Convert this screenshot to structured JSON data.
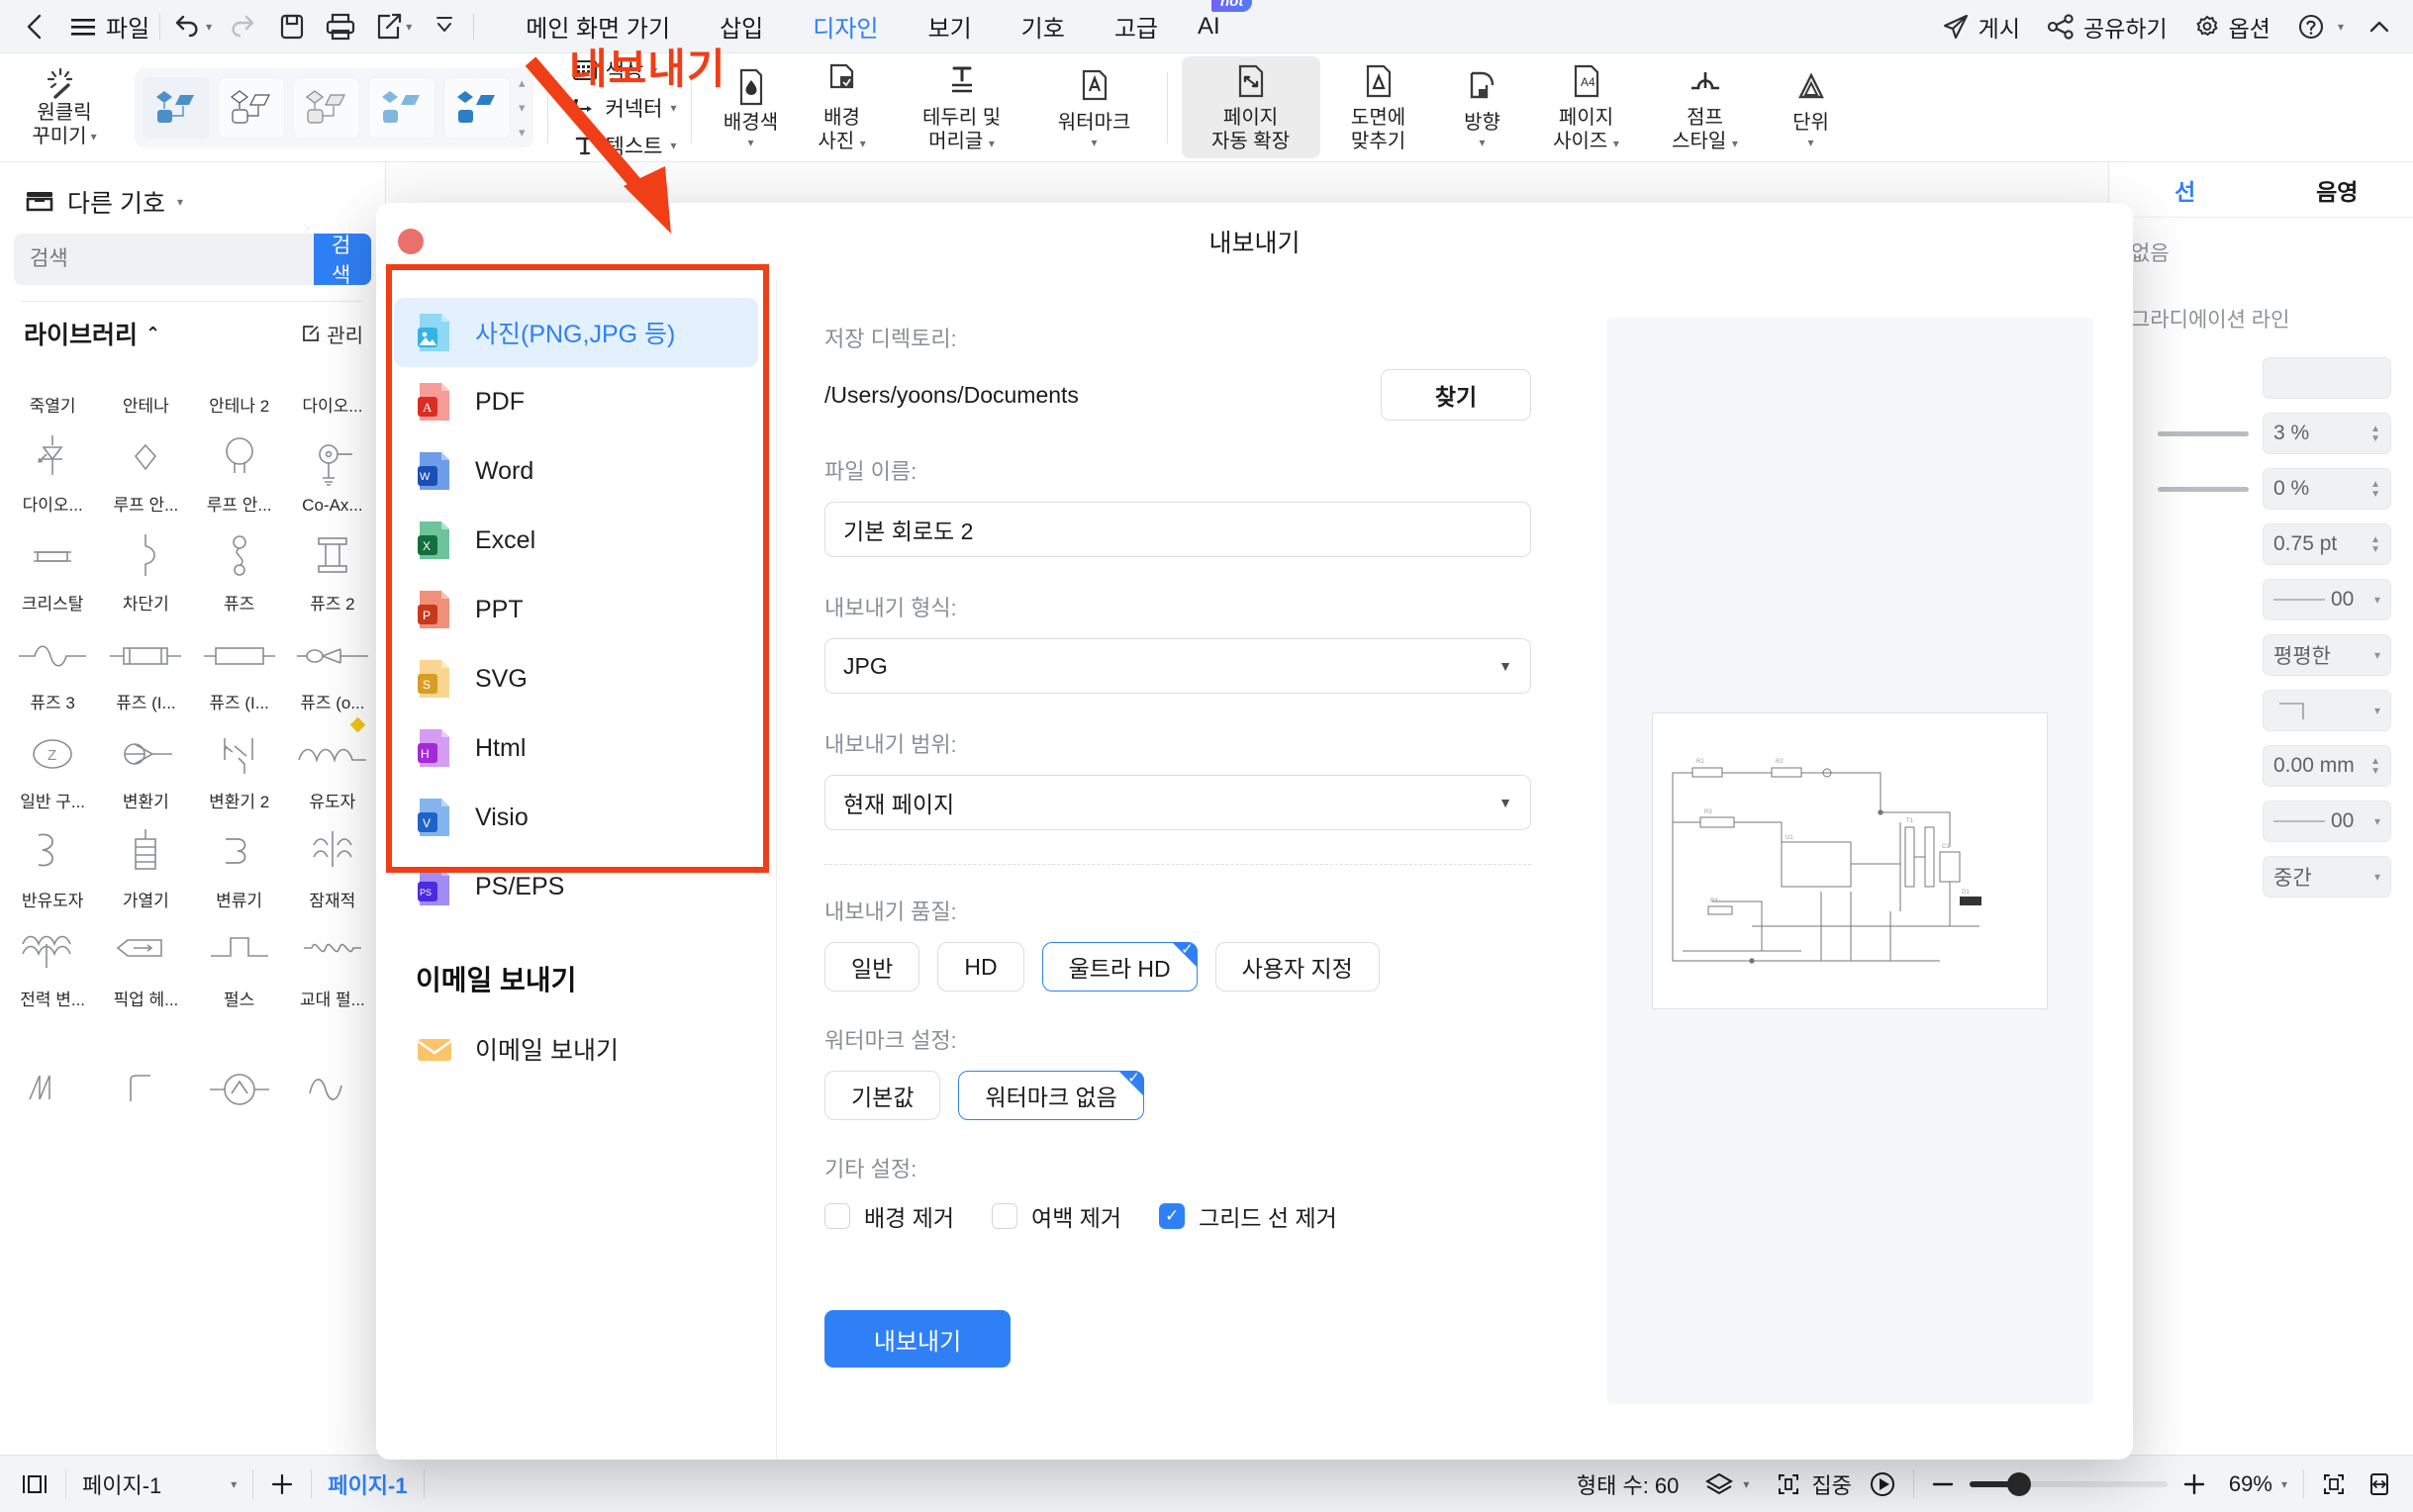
{
  "menubar": {
    "back_icon": "chevron-left-icon",
    "file_label": "파일",
    "undo_icon": "undo-icon",
    "redo_icon": "redo-icon",
    "save_icon": "save-icon",
    "print_icon": "print-icon",
    "export_share_icon": "share-export-icon",
    "more_icon": "chevron-down-icon",
    "tabs": [
      {
        "label": "메인 화면 가기",
        "active": false
      },
      {
        "label": "삽입",
        "active": false
      },
      {
        "label": "디자인",
        "active": true
      },
      {
        "label": "보기",
        "active": false
      },
      {
        "label": "기호",
        "active": false
      },
      {
        "label": "고급",
        "active": false
      }
    ],
    "ai_label": "AI",
    "ai_badge": "hot",
    "right_items": [
      {
        "label": "게시",
        "icon": "send-icon"
      },
      {
        "label": "공유하기",
        "icon": "share-nodes-icon"
      },
      {
        "label": "옵션",
        "icon": "gear-icon"
      },
      {
        "label": "",
        "icon": "help-circle-icon"
      },
      {
        "label": "",
        "icon": "chevron-up-icon"
      }
    ]
  },
  "ribbon": {
    "oneclick_line1": "원클릭",
    "oneclick_line2": "꾸미기",
    "theme_count": 5,
    "selected_theme_index": 0,
    "text_group": [
      {
        "label": "색상",
        "icon": "color-grid-icon"
      },
      {
        "label": "커넥터",
        "icon": "connector-icon"
      },
      {
        "label": "텍스트",
        "icon": "text-t-icon"
      }
    ],
    "buttons": [
      {
        "label_line1": "배경색",
        "label_line2": "",
        "icon": "bg-color-icon",
        "caret": true,
        "active": false
      },
      {
        "label_line1": "배경",
        "label_line2": "사진",
        "icon": "bg-photo-icon",
        "caret": true,
        "active": false
      },
      {
        "label_line1": "테두리 및",
        "label_line2": "머리글",
        "icon": "border-header-icon",
        "caret": true,
        "active": false
      },
      {
        "label_line1": "워터마크",
        "label_line2": "",
        "icon": "watermark-icon",
        "caret": true,
        "active": false
      },
      {
        "label_line1": "페이지",
        "label_line2": "자동 확장",
        "icon": "page-autoexpand-icon",
        "caret": false,
        "active": true
      },
      {
        "label_line1": "도면에",
        "label_line2": "맞추기",
        "icon": "fit-drawing-icon",
        "caret": false,
        "active": false
      },
      {
        "label_line1": "방향",
        "label_line2": "",
        "icon": "orientation-icon",
        "caret": true,
        "active": false
      },
      {
        "label_line1": "페이지",
        "label_line2": "사이즈",
        "icon": "page-size-icon",
        "caret": true,
        "active": false
      },
      {
        "label_line1": "점프",
        "label_line2": "스타일",
        "icon": "jump-style-icon",
        "caret": true,
        "active": false
      },
      {
        "label_line1": "단위",
        "label_line2": "",
        "icon": "unit-icon",
        "caret": true,
        "active": false
      }
    ]
  },
  "left_panel": {
    "header_label": "다른 기호",
    "header_icon": "library-box-icon",
    "search_placeholder": "검색",
    "search_value": "",
    "search_button": "검색",
    "section_title": "라이브러리",
    "section_collapse_icon": "chevron-up-icon",
    "manage_label": "관리",
    "manage_icon": "edit-square-icon",
    "symbols": [
      {
        "caption": "죽열기",
        "shape": "none"
      },
      {
        "caption": "안테나",
        "shape": "none"
      },
      {
        "caption": "안테나 2",
        "shape": "none"
      },
      {
        "caption": "다이오...",
        "shape": "none"
      },
      {
        "caption": "다이오...",
        "shape": "diode-arrow"
      },
      {
        "caption": "루프 안...",
        "shape": "diamond-loop"
      },
      {
        "caption": "루프 안...",
        "shape": "circle-loop"
      },
      {
        "caption": "Co-Ax...",
        "shape": "coax"
      },
      {
        "caption": "크리스탈",
        "shape": "crystal"
      },
      {
        "caption": "차단기",
        "shape": "breaker"
      },
      {
        "caption": "퓨즈",
        "shape": "fuse"
      },
      {
        "caption": "퓨즈 2",
        "shape": "fuse2"
      },
      {
        "caption": "퓨즈 3",
        "shape": "fuse3"
      },
      {
        "caption": "퓨즈 (I...",
        "shape": "fuse-iec1"
      },
      {
        "caption": "퓨즈 (I...",
        "shape": "fuse-iec2"
      },
      {
        "caption": "퓨즈 (o...",
        "shape": "fuse-other"
      },
      {
        "caption": "일반 구...",
        "shape": "z-circle"
      },
      {
        "caption": "변환기",
        "shape": "transducer"
      },
      {
        "caption": "변환기 2",
        "shape": "transducer2"
      },
      {
        "caption": "유도자",
        "shape": "inductor",
        "marker": true
      },
      {
        "caption": "반유도자",
        "shape": "semi-inductor"
      },
      {
        "caption": "가열기",
        "shape": "heater"
      },
      {
        "caption": "변류기",
        "shape": "ct"
      },
      {
        "caption": "잠재적",
        "shape": "potential"
      },
      {
        "caption": "전력 변...",
        "shape": "power-transformer"
      },
      {
        "caption": "픽업 헤...",
        "shape": "pickup-head"
      },
      {
        "caption": "펄스",
        "shape": "pulse"
      },
      {
        "caption": "교대 펄...",
        "shape": "alt-pulse"
      },
      {
        "caption": "",
        "shape": "sawtooth"
      },
      {
        "caption": "",
        "shape": "step"
      },
      {
        "caption": "",
        "shape": "source-circle"
      },
      {
        "caption": "",
        "shape": "sine"
      }
    ]
  },
  "right_panel": {
    "tabs": [
      {
        "label": "선",
        "active": true
      },
      {
        "label": "음영",
        "active": false
      }
    ],
    "rows": [
      {
        "label": "없음",
        "type": "text"
      },
      {
        "label": "그라디에이션 라인",
        "type": "text"
      },
      {
        "label": "",
        "type": "swatch",
        "value": ""
      },
      {
        "label": "",
        "type": "slider-stepper",
        "value": "3 %"
      },
      {
        "label": "",
        "type": "slider-stepper",
        "value": "0 %"
      },
      {
        "label": "",
        "type": "stepper",
        "value": "0.75 pt"
      },
      {
        "label": "",
        "type": "dashselect",
        "value": "00"
      },
      {
        "label": "",
        "type": "select",
        "value": "평평한"
      },
      {
        "label": "",
        "type": "cornerselect",
        "value": ""
      },
      {
        "label": "",
        "type": "stepper",
        "value": "0.00 mm"
      },
      {
        "label": "",
        "type": "dashselect",
        "value": "00"
      },
      {
        "label": "",
        "type": "select",
        "value": "중간"
      }
    ],
    "partial_labels": [
      "선",
      "음영",
      "션 라인",
      "데이션 라인"
    ]
  },
  "statusbar": {
    "layout_icon": "panel-toggle-icon",
    "page_label": "페이지-1",
    "page_caret": "chevron-down-icon",
    "add_page_icon": "plus-icon",
    "page_tab": "페이지-1",
    "shape_count_label": "형태 수: 60",
    "layers_icon": "layers-icon",
    "focus_label": "집중",
    "focus_icon": "focus-frame-icon",
    "play_icon": "play-circle-icon",
    "zoom_out_icon": "minus-icon",
    "zoom_in_icon": "plus-icon",
    "zoom_value": "69%",
    "zoom_caret": "chevron-down-icon",
    "fit_page_icon": "fit-page-icon",
    "fit_width_icon": "fit-width-icon"
  },
  "dialog": {
    "title": "내보내기",
    "close_icon": "close-red-dot",
    "formats": [
      {
        "label": "사진(PNG,JPG 등)",
        "icon": "image-file-icon",
        "color": "#6cc8f0",
        "letter": "",
        "active": true
      },
      {
        "label": "PDF",
        "icon": "pdf-file-icon",
        "color": "#e8493f",
        "letter": "A",
        "active": false
      },
      {
        "label": "Word",
        "icon": "word-file-icon",
        "color": "#2b5fc4",
        "letter": "W",
        "active": false
      },
      {
        "label": "Excel",
        "icon": "excel-file-icon",
        "color": "#1d7044",
        "letter": "X",
        "active": false
      },
      {
        "label": "PPT",
        "icon": "ppt-file-icon",
        "color": "#d4492b",
        "letter": "P",
        "active": false
      },
      {
        "label": "SVG",
        "icon": "svg-file-icon",
        "color": "#dca22c",
        "letter": "S",
        "active": false
      },
      {
        "label": "Html",
        "icon": "html-file-icon",
        "color": "#a83ae0",
        "letter": "H",
        "active": false
      },
      {
        "label": "Visio",
        "icon": "visio-file-icon",
        "color": "#2b6fd4",
        "letter": "V",
        "active": false
      },
      {
        "label": "PS/EPS",
        "icon": "ps-file-icon",
        "color": "#5b3ae0",
        "letter": "PS",
        "active": false
      }
    ],
    "email_section_title": "이메일 보내기",
    "email_item_label": "이메일 보내기",
    "email_icon": "envelope-icon",
    "form": {
      "dir_label": "저장 디렉토리:",
      "dir_value": "/Users/yoons/Documents",
      "browse_button": "찾기",
      "filename_label": "파일 이름:",
      "filename_value": "기본 회로도 2",
      "format_label": "내보내기 형식:",
      "format_value": "JPG",
      "range_label": "내보내기 범위:",
      "range_value": "현재 페이지",
      "quality_label": "내보내기 품질:",
      "quality_options": [
        {
          "label": "일반",
          "selected": false
        },
        {
          "label": "HD",
          "selected": false
        },
        {
          "label": "울트라 HD",
          "selected": true
        },
        {
          "label": "사용자 지정",
          "selected": false
        }
      ],
      "watermark_label": "워터마크 설정:",
      "watermark_options": [
        {
          "label": "기본값",
          "selected": false
        },
        {
          "label": "워터마크 없음",
          "selected": true
        }
      ],
      "other_label": "기타 설정:",
      "checkboxes": [
        {
          "label": "배경 제거",
          "checked": false
        },
        {
          "label": "여백 제거",
          "checked": false
        },
        {
          "label": "그리드 선 제거",
          "checked": true
        }
      ],
      "export_button": "내보내기"
    }
  },
  "annotations": {
    "callout_text": "내보내기",
    "arrow_color": "#f03e16",
    "rect_color": "#f03e16"
  }
}
